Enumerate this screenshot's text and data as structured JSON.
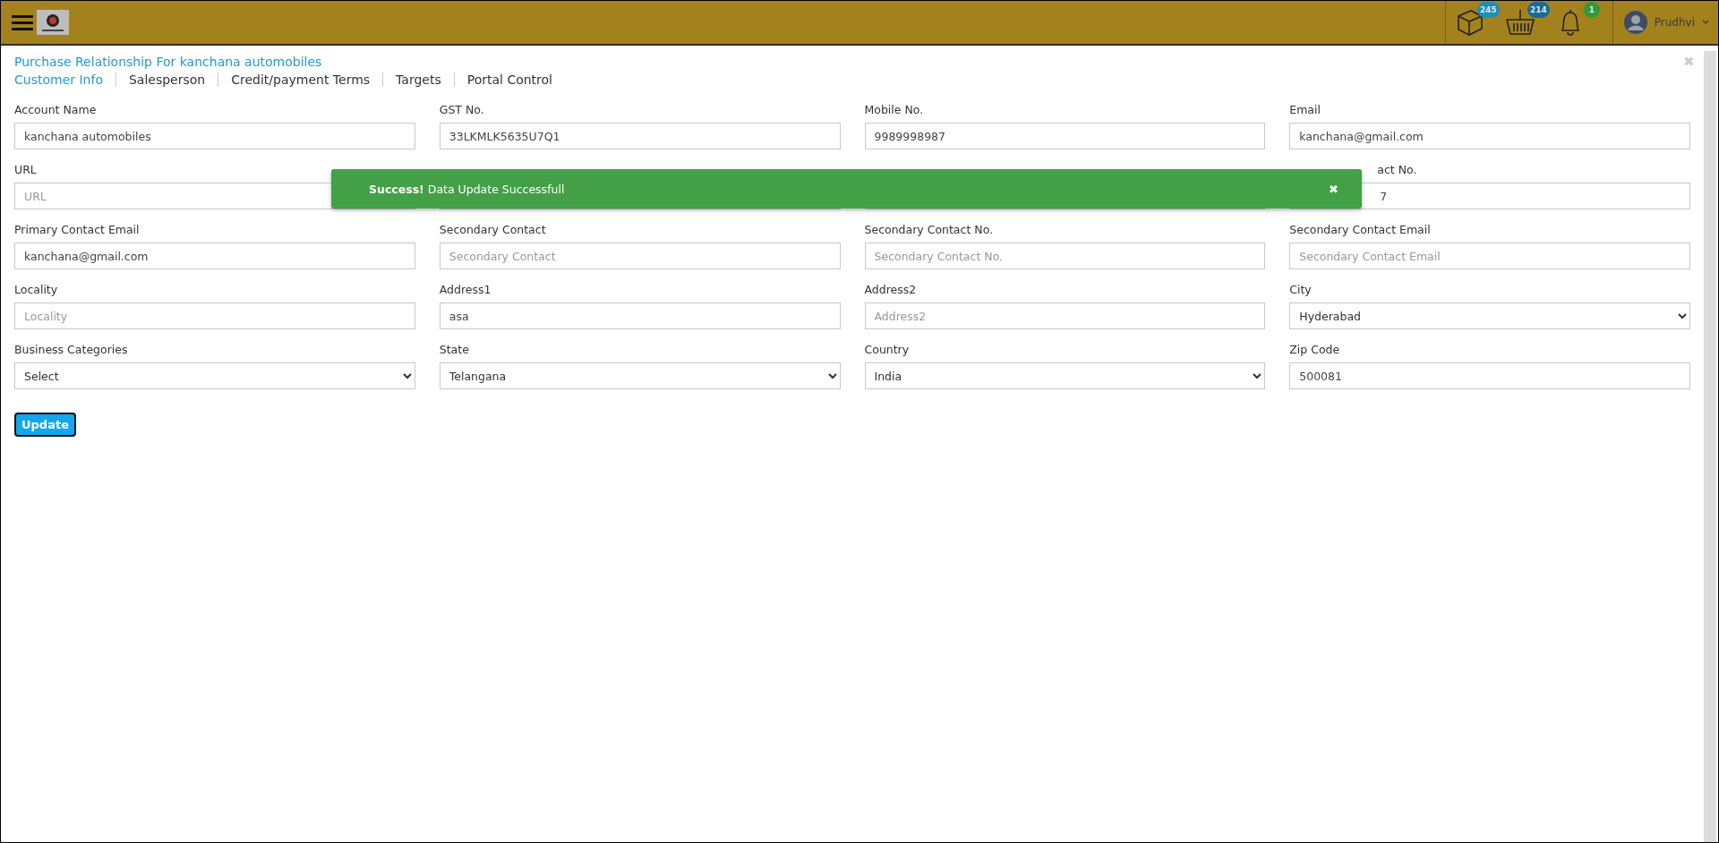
{
  "header": {
    "badges": [
      {
        "count": "245",
        "color": "#1a8fb8"
      },
      {
        "count": "214",
        "color": "#176b95"
      },
      {
        "count": "1",
        "color": "#2e9a3a"
      }
    ],
    "user": {
      "name": "Prudhvi"
    }
  },
  "page": {
    "title": "Purchase Relationship For kanchana automobiles",
    "close": "✖"
  },
  "tabs": [
    {
      "label": "Customer Info",
      "selected": true
    },
    {
      "label": "Salesperson",
      "selected": false
    },
    {
      "label": "Credit/payment Terms",
      "selected": false
    },
    {
      "label": "Targets",
      "selected": false
    },
    {
      "label": "Portal Control",
      "selected": false
    }
  ],
  "fields": [
    {
      "kind": "input",
      "label": "Account Name",
      "value": "kanchana automobiles"
    },
    {
      "kind": "input",
      "label": "GST No.",
      "value": "33LKMLK5635U7Q1"
    },
    {
      "kind": "input",
      "label": "Mobile No.",
      "value": "9989998987"
    },
    {
      "kind": "input",
      "label": "Email",
      "value": "kanchana@gmail.com"
    },
    {
      "kind": "input",
      "label": "URL",
      "placeholder": "URL"
    },
    {
      "kind": "covered"
    },
    {
      "kind": "covered"
    },
    {
      "kind": "partial",
      "label": "act No.",
      "value": "7"
    },
    {
      "kind": "input",
      "label": "Primary Contact Email",
      "value": "kanchana@gmail.com"
    },
    {
      "kind": "input",
      "label": "Secondary Contact",
      "placeholder": "Secondary Contact"
    },
    {
      "kind": "input",
      "label": "Secondary Contact No.",
      "placeholder": "Secondary Contact No."
    },
    {
      "kind": "input",
      "label": "Secondary Contact Email",
      "placeholder": "Secondary Contact Email"
    },
    {
      "kind": "input",
      "label": "Locality",
      "placeholder": "Locality"
    },
    {
      "kind": "input",
      "label": "Address1",
      "value": "asa"
    },
    {
      "kind": "input",
      "label": "Address2",
      "placeholder": "Address2"
    },
    {
      "kind": "select",
      "label": "City",
      "value": "Hyderabad"
    },
    {
      "kind": "select",
      "label": "Business Categories",
      "value": "Select"
    },
    {
      "kind": "select",
      "label": "State",
      "value": "Telangana"
    },
    {
      "kind": "select",
      "label": "Country",
      "value": "India"
    },
    {
      "kind": "input",
      "label": "Zip Code",
      "value": "500081"
    }
  ],
  "update_button": "Update",
  "toast": {
    "message": "**Success!** Data Update Successfull",
    "close": "✖"
  }
}
